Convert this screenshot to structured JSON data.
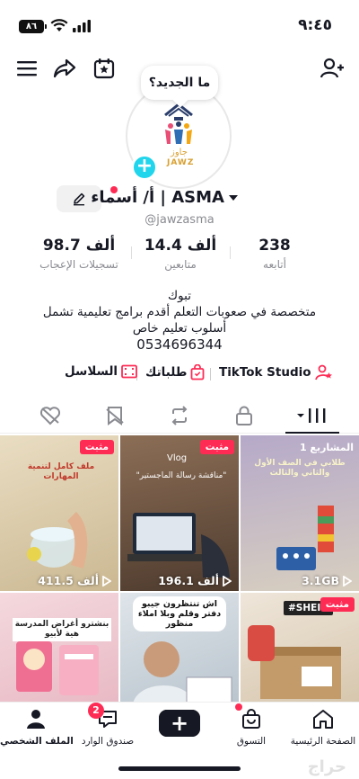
{
  "status_bar": {
    "time": "٩:٤٥",
    "battery": "٨٦"
  },
  "profile": {
    "bubble": "ما الجديد؟",
    "logo_text": "JAWZ",
    "logo_arabic": "جاوز",
    "name": "أ/ أسماء | ASMA",
    "handle": "@jawzasma"
  },
  "stats": [
    {
      "value": "238",
      "label": "أتابعه"
    },
    {
      "value": "14.4 ألف",
      "label": "متابعين"
    },
    {
      "value": "98.7 ألف",
      "label": "تسجيلات الإعجاب"
    }
  ],
  "bio": {
    "line1": "تبوك",
    "line2": "متخصصة في صعوبات التعلم أقدم برامج تعليمية تشمل",
    "line3": "أسلوب تعليم خاص",
    "phone": "0534696344"
  },
  "links": {
    "studio": "TikTok Studio",
    "orders": "طلباتك",
    "series": "السلاسل"
  },
  "grid": [
    {
      "pin": "مثبت",
      "views": "411.5 ألف",
      "overlay": "ملف كامل لتنمية المهارات"
    },
    {
      "pin": "مثبت",
      "views": "196.1 ألف",
      "overlay": "Vlog",
      "caption": "\"مناقشة رسالة الماجستير\""
    },
    {
      "overlay": "المشاريع 1",
      "views": "3.1GB",
      "caption": "طلابي في الصف الأول والثاني والثالث"
    },
    {
      "caption": "بنشترو أغراض المدرسة هية لأبيو"
    },
    {
      "caption": "اش تنتظرون جيبو دفتر وقلم وبلا املاء منظور"
    },
    {
      "tag": "#SHEIN",
      "pin": "مثبت"
    }
  ],
  "bottom_nav": {
    "home": "الصفحة الرئيسية",
    "shop": "التسوق",
    "inbox": "صندوق الوارد",
    "inbox_badge": "2",
    "profile": "الملف الشخصي"
  },
  "watermark": "حراج",
  "colors": {
    "accent": "#fe2c55",
    "cyan": "#20d5ec",
    "text": "#161823",
    "muted": "#8a8b91"
  }
}
